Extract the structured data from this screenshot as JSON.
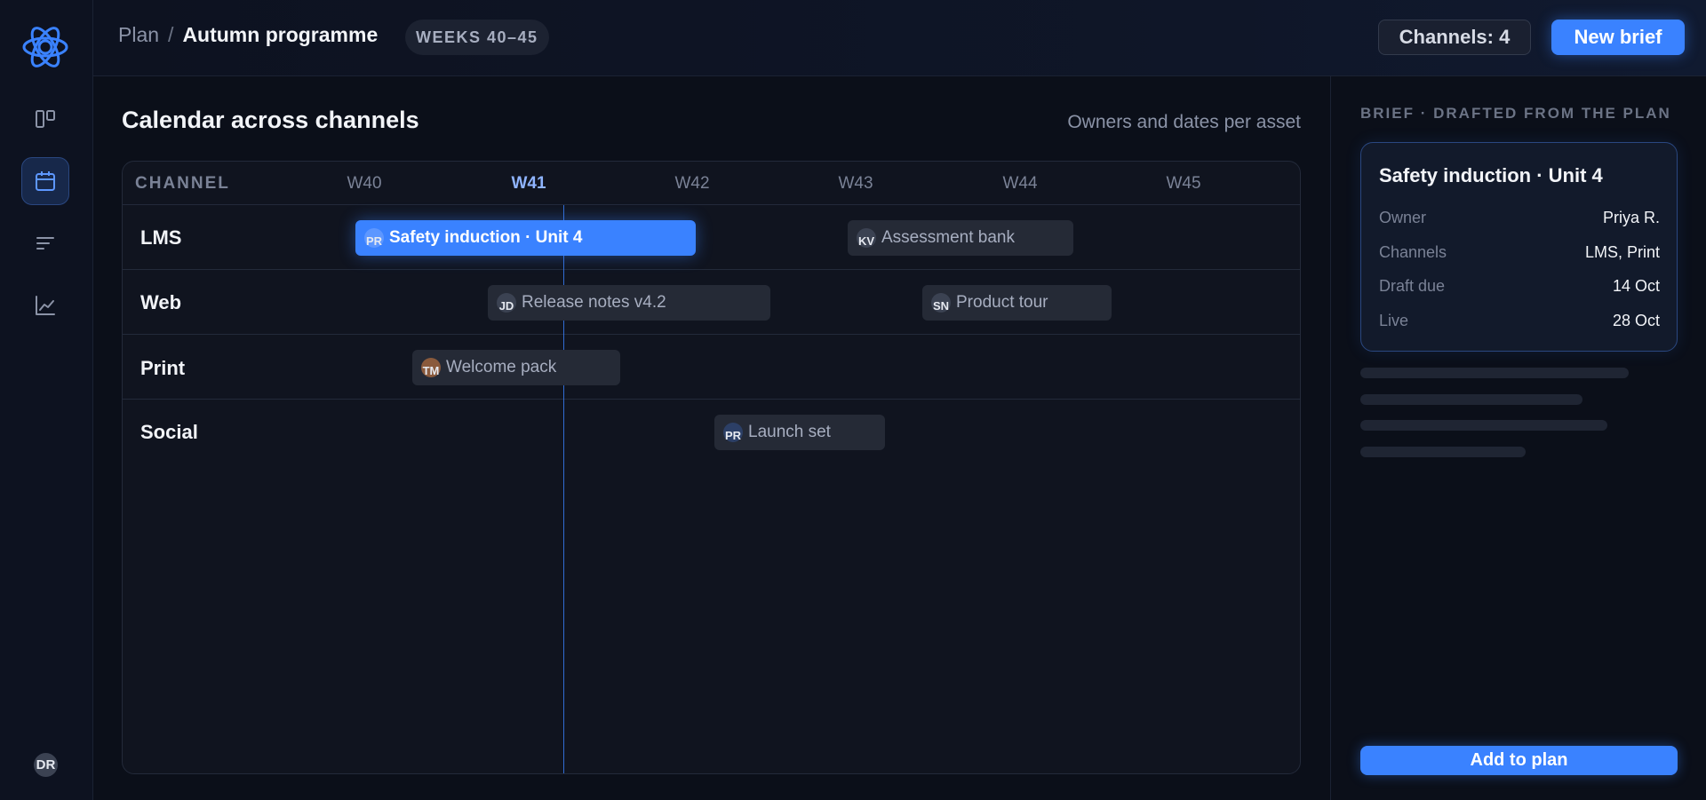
{
  "header": {
    "breadcrumb_root": "Plan",
    "breadcrumb_sep": "/",
    "breadcrumb_current": "Autumn programme",
    "weeks_pill": "WEEKS 40–45",
    "channels_button": "Channels: 4",
    "new_brief_button": "New brief"
  },
  "sidebar": {
    "items": [
      {
        "icon": "board-icon",
        "active": false
      },
      {
        "icon": "calendar-icon",
        "active": true
      },
      {
        "icon": "list-icon",
        "active": false
      },
      {
        "icon": "chart-icon",
        "active": false
      }
    ],
    "user_initials": "DR"
  },
  "main": {
    "title": "Calendar across channels",
    "subtitle": "Owners and dates per asset",
    "column_header": "CHANNEL",
    "weeks": [
      "W40",
      "W41",
      "W42",
      "W43",
      "W44",
      "W45"
    ],
    "current_week": "W41",
    "rows": [
      {
        "label": "LMS"
      },
      {
        "label": "Web"
      },
      {
        "label": "Print"
      },
      {
        "label": "Social"
      }
    ],
    "assets": [
      {
        "row": "LMS",
        "owner": "PR",
        "title": "Safety induction · Unit 4",
        "selected": true
      },
      {
        "row": "LMS",
        "owner": "KV",
        "title": "Assessment bank",
        "selected": false
      },
      {
        "row": "Web",
        "owner": "JD",
        "title": "Release notes v4.2",
        "selected": false
      },
      {
        "row": "Web",
        "owner": "SN",
        "title": "Product tour",
        "selected": false
      },
      {
        "row": "Print",
        "owner": "TM",
        "title": "Welcome pack",
        "selected": false
      },
      {
        "row": "Social",
        "owner": "PR",
        "title": "Launch set",
        "selected": false
      }
    ]
  },
  "panel": {
    "kicker": "BRIEF · DRAFTED FROM THE PLAN",
    "card": {
      "title": "Safety induction · Unit 4",
      "fields": [
        {
          "key": "Owner",
          "value": "Priya R."
        },
        {
          "key": "Channels",
          "value": "LMS, Print"
        },
        {
          "key": "Draft due",
          "value": "14 Oct"
        },
        {
          "key": "Live",
          "value": "28 Oct"
        }
      ]
    },
    "add_button": "Add to plan"
  },
  "colors": {
    "accent": "#3a82ff",
    "background": "#0b0f19",
    "surface": "#10141f"
  }
}
